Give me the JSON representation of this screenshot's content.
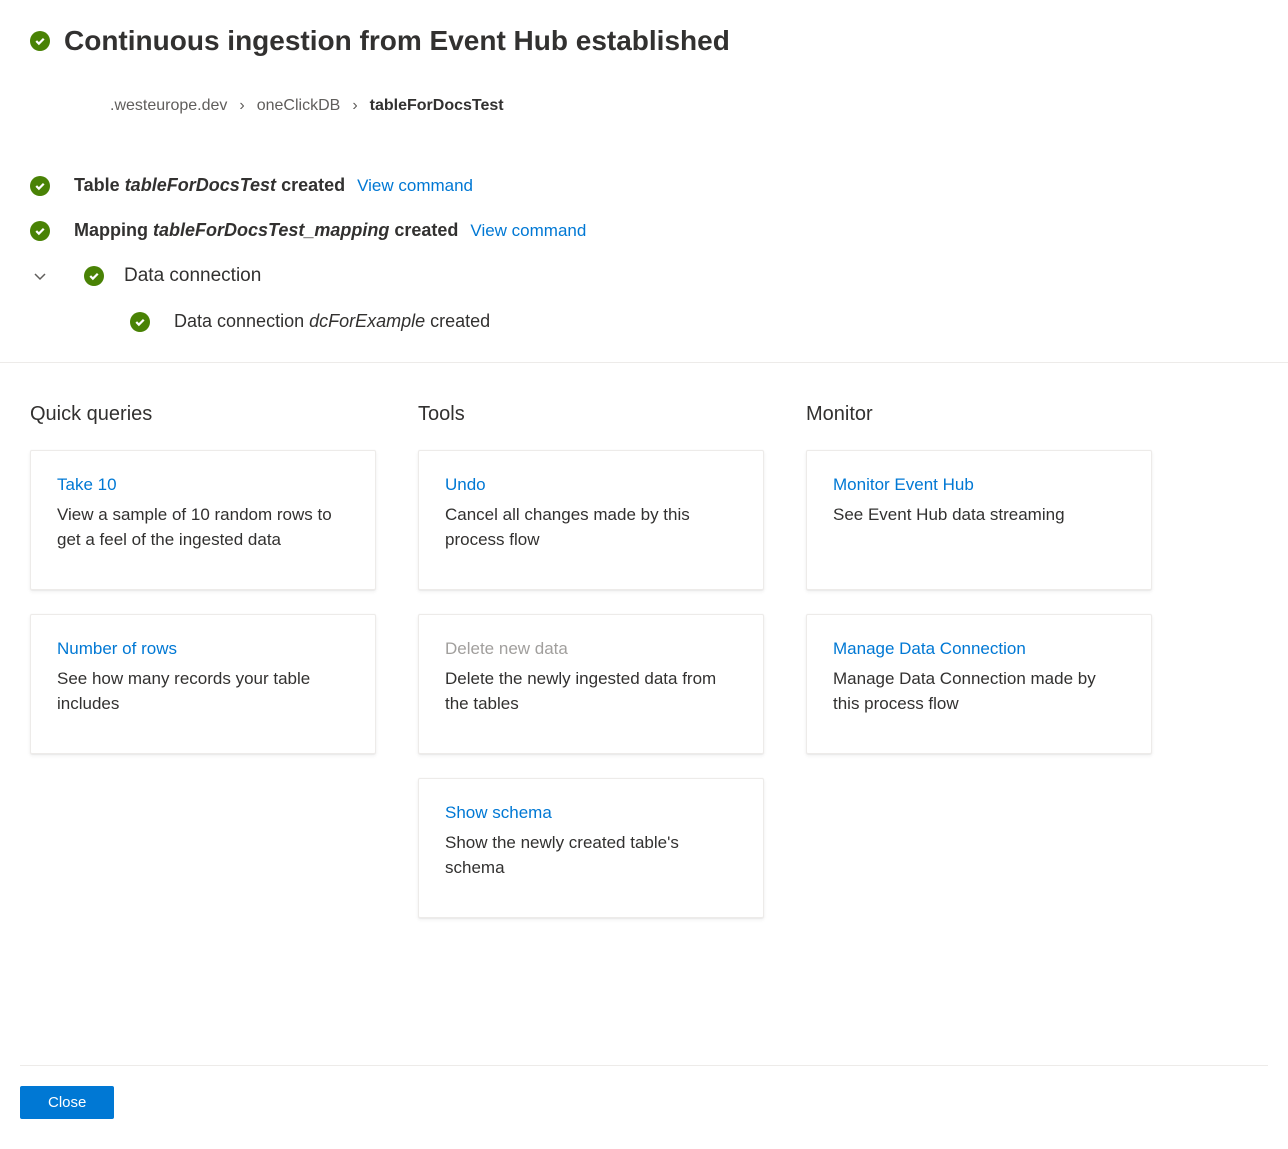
{
  "header": {
    "title": "Continuous ingestion from Event Hub established"
  },
  "breadcrumb": {
    "items": [
      {
        "label": ".westeurope.dev",
        "active": false
      },
      {
        "label": "oneClickDB",
        "active": false
      },
      {
        "label": "tableForDocsTest",
        "active": true
      }
    ]
  },
  "status": {
    "table": {
      "prefix": "Table ",
      "name": "tableForDocsTest",
      "suffix": " created",
      "link": "View command"
    },
    "mapping": {
      "prefix": "Mapping ",
      "name": "tableForDocsTest_mapping",
      "suffix": " created",
      "link": "View command"
    },
    "dataConnection": {
      "title": "Data connection",
      "sub": {
        "prefix": "Data connection ",
        "name": "dcForExample",
        "suffix": " created"
      }
    }
  },
  "sections": {
    "quickQueries": {
      "title": "Quick queries",
      "cards": [
        {
          "title": "Take 10",
          "desc": "View a sample of 10 random rows to get a feel of the ingested data",
          "disabled": false
        },
        {
          "title": "Number of rows",
          "desc": "See how many records your table includes",
          "disabled": false
        }
      ]
    },
    "tools": {
      "title": "Tools",
      "cards": [
        {
          "title": "Undo",
          "desc": "Cancel all changes made by this process flow",
          "disabled": false
        },
        {
          "title": "Delete new data",
          "desc": "Delete the newly ingested data from the tables",
          "disabled": true
        },
        {
          "title": "Show schema",
          "desc": "Show the newly created table's schema",
          "disabled": false
        }
      ]
    },
    "monitor": {
      "title": "Monitor",
      "cards": [
        {
          "title": "Monitor Event Hub",
          "desc": "See Event Hub data streaming",
          "disabled": false
        },
        {
          "title": "Manage Data Connection",
          "desc": "Manage Data Connection made by this process flow",
          "disabled": false
        }
      ]
    }
  },
  "footer": {
    "closeLabel": "Close"
  }
}
